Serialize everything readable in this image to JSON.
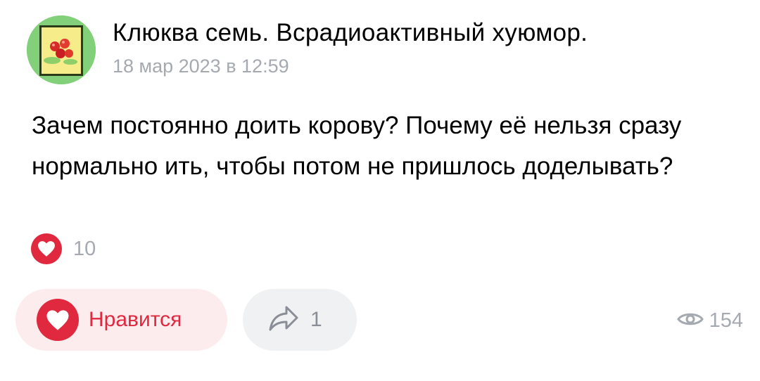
{
  "post": {
    "group_name": "Клюква семь. Всрадиоактивный хуюмор.",
    "date": "18 мар 2023 в 12:59",
    "text": "Зачем постоянно доить корову? Почему её нельзя сразу нормально ить, чтобы потом не пришлось доделывать?"
  },
  "reactions": {
    "icon": "heart-icon",
    "count": "10"
  },
  "actions": {
    "like_label": "Нравится",
    "like_icon": "heart-icon",
    "share_icon": "share-arrow-icon",
    "share_count": "1"
  },
  "views": {
    "icon": "eye-icon",
    "count": "154"
  },
  "colors": {
    "accent_red": "#e0283f",
    "like_bg": "#fdecee",
    "share_bg": "#f0f1f3",
    "muted_text": "#a5a9b0",
    "avatar_bg": "#82d07a"
  }
}
